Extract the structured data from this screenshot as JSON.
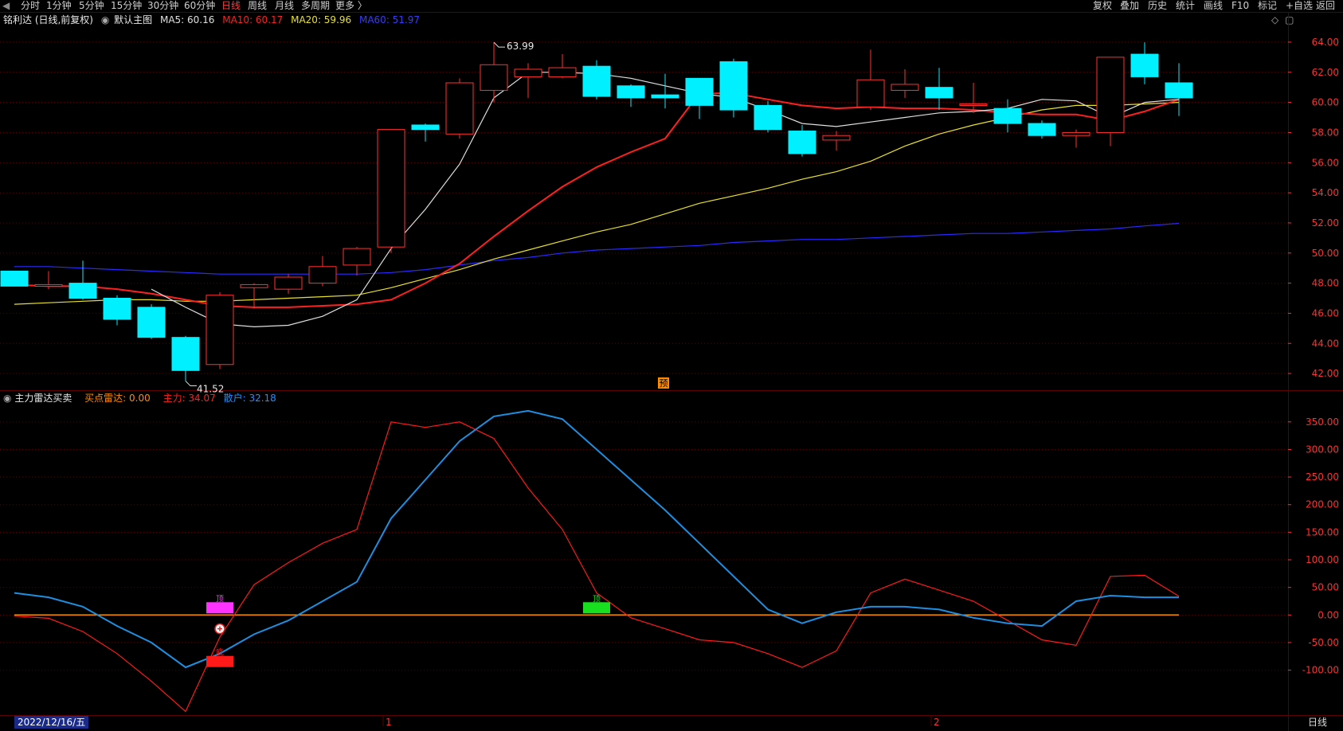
{
  "toolbar": {
    "left_items": [
      "分时",
      "1分钟",
      "5分钟",
      "15分钟",
      "30分钟",
      "60分钟",
      "日线",
      "周线",
      "月线",
      "多周期",
      "更多 〉"
    ],
    "active_item": "日线",
    "right_items": [
      "复权",
      "叠加",
      "历史",
      "统计",
      "画线",
      "F10",
      "标记",
      "+自选",
      "返回"
    ]
  },
  "main_chart": {
    "stock_title": "铭利达 (日线,前复权)",
    "template_label": "默认主图",
    "ma5": {
      "label": "MA5: 60.16",
      "color": "#e0e0e0"
    },
    "ma10": {
      "label": "MA10: 60.17",
      "color": "#ff2020"
    },
    "ma20": {
      "label": "MA20: 59.96",
      "color": "#e8e030"
    },
    "ma60": {
      "label": "MA60: 51.97",
      "color": "#2a2aff"
    },
    "high_marker": "63.99",
    "low_marker": "41.52",
    "forecast_badge": "预",
    "y_ticks": [
      "64.00",
      "62.00",
      "60.00",
      "58.00",
      "56.00",
      "54.00",
      "52.00",
      "50.00",
      "48.00",
      "46.00",
      "44.00",
      "42.00"
    ],
    "y_range": [
      41,
      65
    ],
    "candles": [
      {
        "o": 48.8,
        "h": 48.8,
        "l": 47.8,
        "c": 47.8
      },
      {
        "o": 47.8,
        "h": 48.8,
        "l": 47.6,
        "c": 47.9
      },
      {
        "o": 48.0,
        "h": 49.5,
        "l": 46.9,
        "c": 47.0
      },
      {
        "o": 47.0,
        "h": 47.2,
        "l": 45.2,
        "c": 45.6
      },
      {
        "o": 46.4,
        "h": 46.6,
        "l": 44.3,
        "c": 44.4
      },
      {
        "o": 44.4,
        "h": 44.5,
        "l": 41.5,
        "c": 42.2
      },
      {
        "o": 42.6,
        "h": 47.4,
        "l": 42.3,
        "c": 47.2
      },
      {
        "o": 47.7,
        "h": 48.0,
        "l": 46.3,
        "c": 47.9
      },
      {
        "o": 47.6,
        "h": 48.6,
        "l": 47.3,
        "c": 48.4
      },
      {
        "o": 48.0,
        "h": 49.8,
        "l": 47.8,
        "c": 49.1
      },
      {
        "o": 49.2,
        "h": 50.4,
        "l": 48.5,
        "c": 50.3
      },
      {
        "o": 50.4,
        "h": 52.8,
        "l": 50.0,
        "c": 58.2
      },
      {
        "o": 58.5,
        "h": 58.6,
        "l": 57.4,
        "c": 58.2
      },
      {
        "o": 57.9,
        "h": 61.6,
        "l": 57.6,
        "c": 61.3
      },
      {
        "o": 60.8,
        "h": 63.99,
        "l": 60.0,
        "c": 62.5
      },
      {
        "o": 61.7,
        "h": 62.6,
        "l": 60.3,
        "c": 62.2
      },
      {
        "o": 61.7,
        "h": 63.2,
        "l": 61.6,
        "c": 62.3
      },
      {
        "o": 62.4,
        "h": 62.8,
        "l": 60.2,
        "c": 60.4
      },
      {
        "o": 61.1,
        "h": 61.2,
        "l": 59.7,
        "c": 60.3
      },
      {
        "o": 60.5,
        "h": 61.9,
        "l": 59.6,
        "c": 60.3
      },
      {
        "o": 61.6,
        "h": 61.6,
        "l": 58.9,
        "c": 59.8
      },
      {
        "o": 62.7,
        "h": 62.9,
        "l": 59.0,
        "c": 59.5
      },
      {
        "o": 59.8,
        "h": 60.1,
        "l": 58.0,
        "c": 58.2
      },
      {
        "o": 58.1,
        "h": 58.5,
        "l": 56.4,
        "c": 56.6
      },
      {
        "o": 57.5,
        "h": 58.1,
        "l": 56.8,
        "c": 57.8
      },
      {
        "o": 59.7,
        "h": 63.5,
        "l": 59.5,
        "c": 61.5
      },
      {
        "o": 60.8,
        "h": 62.2,
        "l": 60.3,
        "c": 61.2
      },
      {
        "o": 61.0,
        "h": 62.3,
        "l": 59.5,
        "c": 60.3
      },
      {
        "o": 59.9,
        "h": 61.3,
        "l": 59.3,
        "c": 59.9
      },
      {
        "o": 59.6,
        "h": 60.2,
        "l": 58.0,
        "c": 58.6
      },
      {
        "o": 58.6,
        "h": 58.8,
        "l": 57.6,
        "c": 57.8
      },
      {
        "o": 57.8,
        "h": 58.2,
        "l": 57.0,
        "c": 58.0
      },
      {
        "o": 58.0,
        "h": 63.0,
        "l": 57.1,
        "c": 63.0
      },
      {
        "o": 63.2,
        "h": 63.99,
        "l": 61.2,
        "c": 61.7
      },
      {
        "o": 61.3,
        "h": 62.6,
        "l": 59.1,
        "c": 60.3
      }
    ],
    "ma5_values": [
      null,
      null,
      null,
      null,
      47.6,
      46.4,
      45.3,
      45.1,
      45.2,
      45.8,
      46.9,
      50.3,
      52.9,
      55.9,
      60.3,
      62.0,
      62.0,
      61.9,
      61.6,
      61.1,
      60.6,
      60.3,
      59.5,
      58.6,
      58.4,
      58.7,
      59.0,
      59.3,
      59.4,
      59.6,
      60.2,
      60.1,
      59.0,
      60.0,
      60.2
    ],
    "ma10_values": [
      47.9,
      47.8,
      47.8,
      47.6,
      47.3,
      46.9,
      46.5,
      46.4,
      46.4,
      46.5,
      46.6,
      46.9,
      48.0,
      49.3,
      51.1,
      52.8,
      54.4,
      55.7,
      56.7,
      57.6,
      60.6,
      60.6,
      60.2,
      59.8,
      59.6,
      59.7,
      59.6,
      59.6,
      59.5,
      59.3,
      59.2,
      59.2,
      58.8,
      59.4,
      60.2
    ],
    "ma20_values": [
      46.6,
      46.7,
      46.8,
      46.9,
      46.9,
      46.8,
      46.8,
      46.9,
      47.0,
      47.1,
      47.2,
      47.7,
      48.3,
      48.9,
      49.6,
      50.2,
      50.8,
      51.4,
      51.9,
      52.6,
      53.3,
      53.8,
      54.3,
      54.9,
      55.4,
      56.1,
      57.1,
      57.9,
      58.5,
      59.0,
      59.5,
      59.8,
      59.8,
      59.9,
      60.0
    ],
    "ma60_values": [
      49.1,
      49.1,
      49.0,
      48.9,
      48.8,
      48.7,
      48.6,
      48.6,
      48.6,
      48.6,
      48.6,
      48.7,
      48.9,
      49.2,
      49.5,
      49.7,
      50.0,
      50.2,
      50.3,
      50.4,
      50.5,
      50.7,
      50.8,
      50.9,
      50.9,
      51.0,
      51.1,
      51.2,
      51.3,
      51.3,
      51.4,
      51.5,
      51.6,
      51.8,
      51.97
    ]
  },
  "indicator": {
    "name": "主力雷达买卖",
    "buy_radar_label": "买点雷达: 0.00",
    "main_force_label": "主力: 34.07",
    "retail_label": "散户: 32.18",
    "y_ticks": [
      "350.00",
      "300.00",
      "250.00",
      "200.00",
      "150.00",
      "100.00",
      "50.00",
      "0.00",
      "-50.00",
      "-100.00"
    ],
    "y_range": [
      -180,
      380
    ],
    "main_force": [
      -2,
      -6,
      -30,
      -70,
      -120,
      -175,
      -40,
      55,
      95,
      130,
      155,
      350,
      340,
      350,
      320,
      230,
      155,
      40,
      -5,
      -25,
      -45,
      -50,
      -70,
      -95,
      -65,
      40,
      65,
      45,
      25,
      -10,
      -45,
      -55,
      70,
      72,
      34
    ],
    "retail": [
      40,
      32,
      15,
      -20,
      -50,
      -95,
      -70,
      -35,
      -10,
      25,
      60,
      175,
      245,
      315,
      360,
      370,
      355,
      300,
      245,
      190,
      130,
      70,
      10,
      -15,
      5,
      15,
      15,
      10,
      -5,
      -15,
      -20,
      25,
      35,
      32,
      32
    ],
    "buy_radar": 0,
    "markers": [
      {
        "index": 6,
        "label": "底",
        "side": "low",
        "color": "#ff1a1a"
      },
      {
        "index": 6,
        "label": "顶",
        "side": "high",
        "color": "#ff33ff"
      },
      {
        "index": 17,
        "label": "顶",
        "side": "high",
        "color": "#18e020"
      }
    ]
  },
  "x_axis": {
    "month_labels": [
      {
        "index": 11,
        "text": "1"
      },
      {
        "index": 27,
        "text": "2"
      }
    ]
  },
  "status": {
    "date": "2022/12/16/五",
    "period": "日线"
  },
  "colors": {
    "up": "#ff3030",
    "down": "#00f0ff",
    "grid": "#5a0000",
    "axis_text": "#ff3030"
  }
}
